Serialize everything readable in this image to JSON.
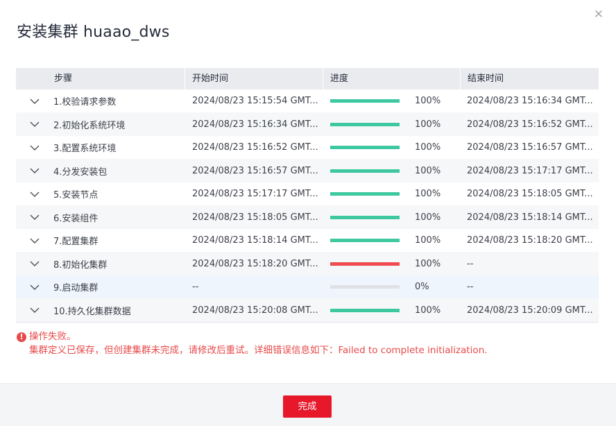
{
  "dialog": {
    "title": "安装集群 huaao_dws",
    "close_icon": "close-icon"
  },
  "table": {
    "headers": [
      "步骤",
      "开始时间",
      "进度",
      "结束时间"
    ],
    "rows": [
      {
        "step": "1.校验请求参数",
        "start": "2024/08/23 15:15:54 GMT...",
        "progress": 100,
        "progress_text": "100%",
        "status": "success",
        "end": "2024/08/23 15:16:34 GMT..."
      },
      {
        "step": "2.初始化系统环境",
        "start": "2024/08/23 15:16:34 GMT...",
        "progress": 100,
        "progress_text": "100%",
        "status": "success",
        "end": "2024/08/23 15:16:52 GMT..."
      },
      {
        "step": "3.配置系统环境",
        "start": "2024/08/23 15:16:52 GMT...",
        "progress": 100,
        "progress_text": "100%",
        "status": "success",
        "end": "2024/08/23 15:16:57 GMT..."
      },
      {
        "step": "4.分发安装包",
        "start": "2024/08/23 15:16:57 GMT...",
        "progress": 100,
        "progress_text": "100%",
        "status": "success",
        "end": "2024/08/23 15:17:17 GMT..."
      },
      {
        "step": "5.安装节点",
        "start": "2024/08/23 15:17:17 GMT...",
        "progress": 100,
        "progress_text": "100%",
        "status": "success",
        "end": "2024/08/23 15:18:05 GMT..."
      },
      {
        "step": "6.安装组件",
        "start": "2024/08/23 15:18:05 GMT...",
        "progress": 100,
        "progress_text": "100%",
        "status": "success",
        "end": "2024/08/23 15:18:14 GMT..."
      },
      {
        "step": "7.配置集群",
        "start": "2024/08/23 15:18:14 GMT...",
        "progress": 100,
        "progress_text": "100%",
        "status": "success",
        "end": "2024/08/23 15:18:20 GMT..."
      },
      {
        "step": "8.初始化集群",
        "start": "2024/08/23 15:18:20 GMT...",
        "progress": 100,
        "progress_text": "100%",
        "status": "failed",
        "end": "--"
      },
      {
        "step": "9.启动集群",
        "start": "--",
        "progress": 0,
        "progress_text": "0%",
        "status": "pending",
        "end": "--"
      },
      {
        "step": "10.持久化集群数据",
        "start": "2024/08/23 15:20:08 GMT...",
        "progress": 100,
        "progress_text": "100%",
        "status": "success",
        "end": "2024/08/23 15:20:09 GMT..."
      }
    ]
  },
  "colors": {
    "success": "#3ec8a0",
    "failed": "#f04b4f",
    "track": "#dfe1e6",
    "error_text": "#e84a4a",
    "primary_button": "#e6182a"
  },
  "error": {
    "icon": "error-icon",
    "title": "操作失败。",
    "message": "集群定义已保存，但创建集群未完成，请修改后重试。详细错误信息如下：Failed to complete initialization."
  },
  "footer": {
    "done_label": "完成"
  }
}
